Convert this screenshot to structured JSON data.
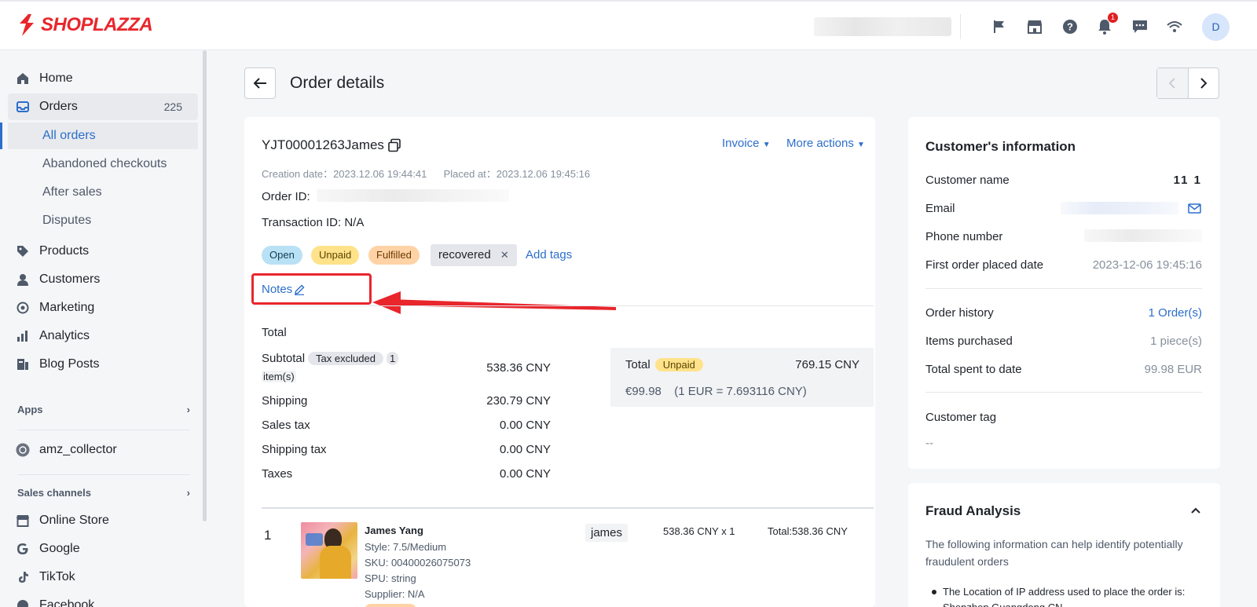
{
  "brand": {
    "logo_text": "SHOPLAZZA"
  },
  "topbar": {
    "notification_count": "1",
    "avatar_initial": "D"
  },
  "sidebar": {
    "items": [
      {
        "label": "Home"
      },
      {
        "label": "Orders",
        "count": "225"
      },
      {
        "label": "Products"
      },
      {
        "label": "Customers"
      },
      {
        "label": "Marketing"
      },
      {
        "label": "Analytics"
      },
      {
        "label": "Blog Posts"
      }
    ],
    "order_sub": [
      "All orders",
      "Abandoned checkouts",
      "After sales",
      "Disputes"
    ],
    "apps_title": "Apps",
    "apps": [
      {
        "label": "amz_collector"
      }
    ],
    "channels_title": "Sales channels",
    "channels": [
      {
        "label": "Online Store"
      },
      {
        "label": "Google"
      },
      {
        "label": "TikTok"
      },
      {
        "label": "Facebook"
      }
    ]
  },
  "page": {
    "title": "Order details"
  },
  "order": {
    "number": "YJT00001263James",
    "invoice_label": "Invoice",
    "more_actions_label": "More actions",
    "creation_label": "Creation date：",
    "creation_value": "2023.12.06 19:44:41",
    "placed_label": "Placed at：",
    "placed_value": "2023.12.06 19:45:16",
    "order_id_label": "Order ID:",
    "transaction_label": "Transaction ID: N/A",
    "tags": {
      "open": "Open",
      "unpaid": "Unpaid",
      "fulfilled": "Fulfilled",
      "recovered": "recovered",
      "add": "Add tags"
    },
    "notes_label": "Notes"
  },
  "totals": {
    "section_title": "Total",
    "subtotal_label": "Subtotal",
    "tax_pill": "Tax excluded",
    "items_count_a": "1",
    "items_count_b": "item(s)",
    "subtotal_value": "538.36 CNY",
    "shipping_label": "Shipping",
    "shipping_value": "230.79 CNY",
    "sales_tax_label": "Sales tax",
    "sales_tax_value": "0.00 CNY",
    "shipping_tax_label": "Shipping tax",
    "shipping_tax_value": "0.00 CNY",
    "taxes_label": "Taxes",
    "taxes_value": "0.00 CNY",
    "summary_label": "Total",
    "summary_status": "Unpaid",
    "summary_value": "769.15 CNY",
    "summary_eur": "€99.98",
    "summary_rate": "(1 EUR = 7.693116 CNY)"
  },
  "line_item": {
    "index": "1",
    "name": "James Yang",
    "style": "Style: 7.5/Medium",
    "sku": "SKU: 00400026075073",
    "spu": "SPU: string",
    "supplier": "Supplier: N/A",
    "tag": "james",
    "price_qty": "538.36 CNY x 1",
    "total": "Total:538.36 CNY"
  },
  "customer": {
    "title": "Customer's information",
    "name_label": "Customer name",
    "name_value": "11 1",
    "email_label": "Email",
    "phone_label": "Phone number",
    "first_order_label": "First order placed date",
    "first_order_value": "2023-12-06 19:45:16",
    "history_label": "Order history",
    "history_value": "1 Order(s)",
    "items_label": "Items purchased",
    "items_value": "1 piece(s)",
    "spent_label": "Total spent to date",
    "spent_value": "99.98 EUR",
    "tag_label": "Customer tag",
    "tag_value": "--"
  },
  "fraud": {
    "title": "Fraud Analysis",
    "desc": "The following information can help identify potentially fraudulent orders",
    "bullet": "The Location of IP address used to place the order is: Shenzhen,Guangdong,CN"
  },
  "colors": {
    "accent": "#2c6ecb",
    "brand": "#e8262c",
    "highlight": "#e8262c"
  }
}
